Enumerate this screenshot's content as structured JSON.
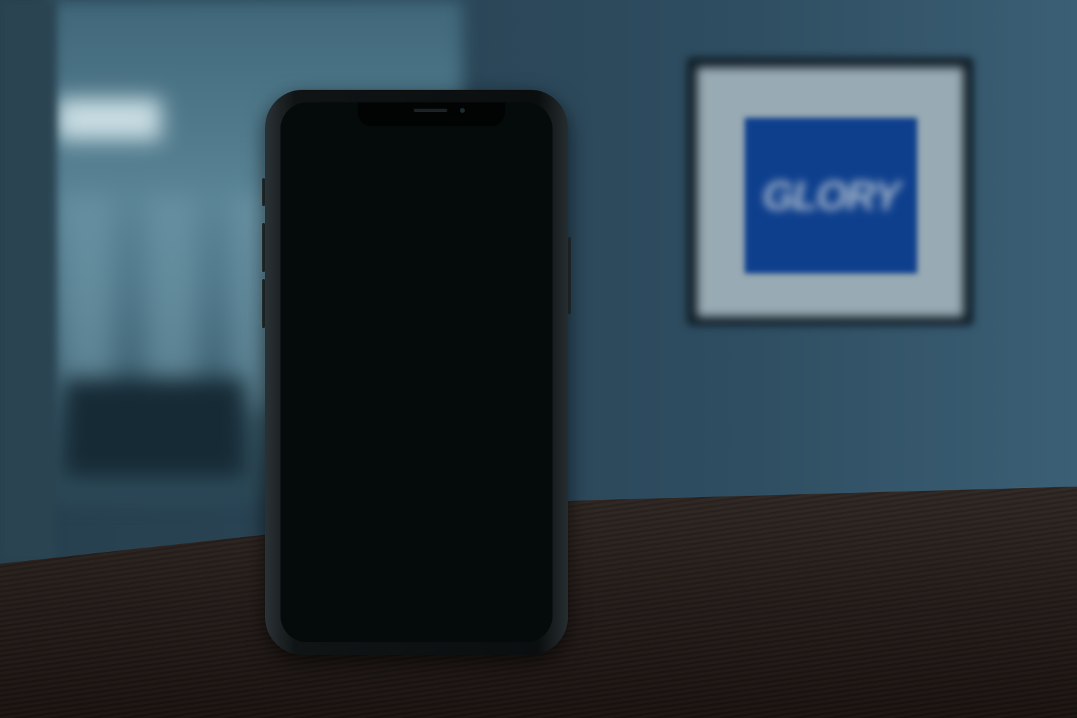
{
  "scene": {
    "sign_logo_text": "GLORY",
    "colors": {
      "wall": "#2a4556",
      "sign_blue": "#0e3f8d",
      "table": "#2e2622",
      "screen": "#050a0b"
    }
  }
}
